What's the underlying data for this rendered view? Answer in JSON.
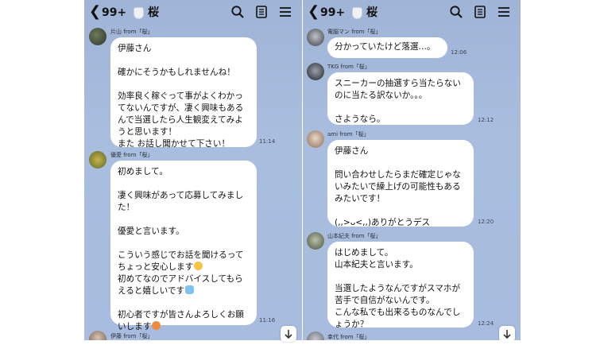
{
  "panes": [
    {
      "back_icon": "chevron-left-icon",
      "unread_count": "99+",
      "room_title": "桜",
      "header_icons": [
        "search-icon",
        "note-icon",
        "menu-icon"
      ],
      "messages": [
        {
          "sender": "片山 from「桜」",
          "time": "11:14",
          "lines": [
            "伊藤さん",
            "",
            "確かにそうかもしれませんね！",
            "",
            "効率良く稼ぐって事がよくわかってないんですが、凄く興味もあるんで当選したら人生観変えてみようと思います！",
            "また お話し聞かせて下さい！"
          ]
        },
        {
          "sender": "優愛 from「桜」",
          "time": "11:16",
          "lines": [
            "初めまして。",
            "",
            "凄く興味があって応募してみました！",
            "",
            "優愛と言います。",
            "",
            "こういう感じでお話を聞けるってちょっと安心します",
            "初めてなのでアドバイスしてもらえると嬉しいです",
            "",
            "初心者ですが皆さんよろしくお願いします"
          ]
        },
        {
          "sender": "伊藤 from「桜」"
        }
      ]
    },
    {
      "back_icon": "chevron-left-icon",
      "unread_count": "99+",
      "room_title": "桜",
      "header_icons": [
        "search-icon",
        "note-icon",
        "menu-icon"
      ],
      "messages": [
        {
          "sender": "電脳マン from「桜」",
          "time": "12:06",
          "lines": [
            "分かっていたけど落選…。"
          ]
        },
        {
          "sender": "TKG from「桜」",
          "time": "12:12",
          "lines": [
            "スニーカーの抽選すら当たらないのに当たる訳ないか。。。",
            "",
            "さようなら。"
          ]
        },
        {
          "sender": "ami from「桜」",
          "time": "12:20",
          "lines": [
            "伊藤さん",
            "",
            "問い合わせしたらまだ確定じゃないみたいで繰上げの可能性もあるみたいです！",
            "",
            "(,,>ᴗ<,,)ありがとうデス"
          ]
        },
        {
          "sender": "山本紀夫 from「桜」",
          "time": "12:24",
          "lines": [
            "はじめまして。",
            "山本紀夫と言います。",
            "",
            "当選したようなんですがスマホが苦手で自信がないんです。",
            "こんな私でも出来るものなんでしょうか？"
          ]
        },
        {
          "sender": "幸代 from「桜」"
        }
      ]
    }
  ],
  "colors": {
    "chat_bg": "#a7bcde",
    "bubble": "#ffffff",
    "text": "#111111"
  }
}
